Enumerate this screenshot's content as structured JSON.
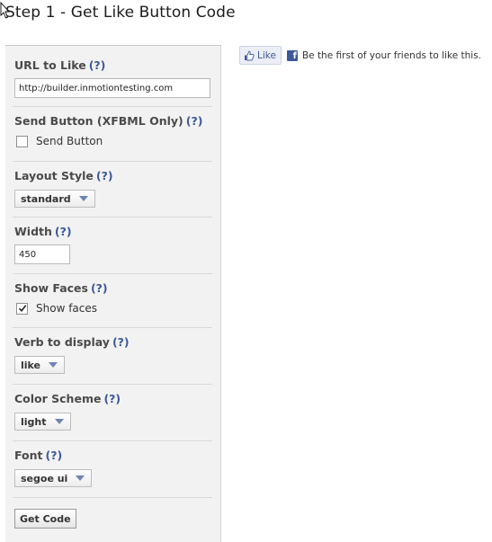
{
  "title": "Step 1 - Get Like Button Code",
  "help_mark": "(?)",
  "url": {
    "label": "URL to Like",
    "value": "http://builder.inmotiontesting.com"
  },
  "send_button": {
    "label": "Send Button (XFBML Only)",
    "checkbox_label": "Send Button",
    "checked": false
  },
  "layout_style": {
    "label": "Layout Style",
    "selected": "standard"
  },
  "width": {
    "label": "Width",
    "value": "450"
  },
  "show_faces": {
    "label": "Show Faces",
    "checkbox_label": "Show faces",
    "checked": true
  },
  "verb": {
    "label": "Verb to display",
    "selected": "like"
  },
  "color_scheme": {
    "label": "Color Scheme",
    "selected": "light"
  },
  "font": {
    "label": "Font",
    "selected": "segoe ui"
  },
  "get_code_label": "Get Code",
  "preview": {
    "like_label": "Like",
    "facebook_icon": "f",
    "social_text": "Be the first of your friends to like this."
  },
  "colors": {
    "facebook_blue": "#3b5998",
    "panel_bg": "#f2f2f2"
  }
}
